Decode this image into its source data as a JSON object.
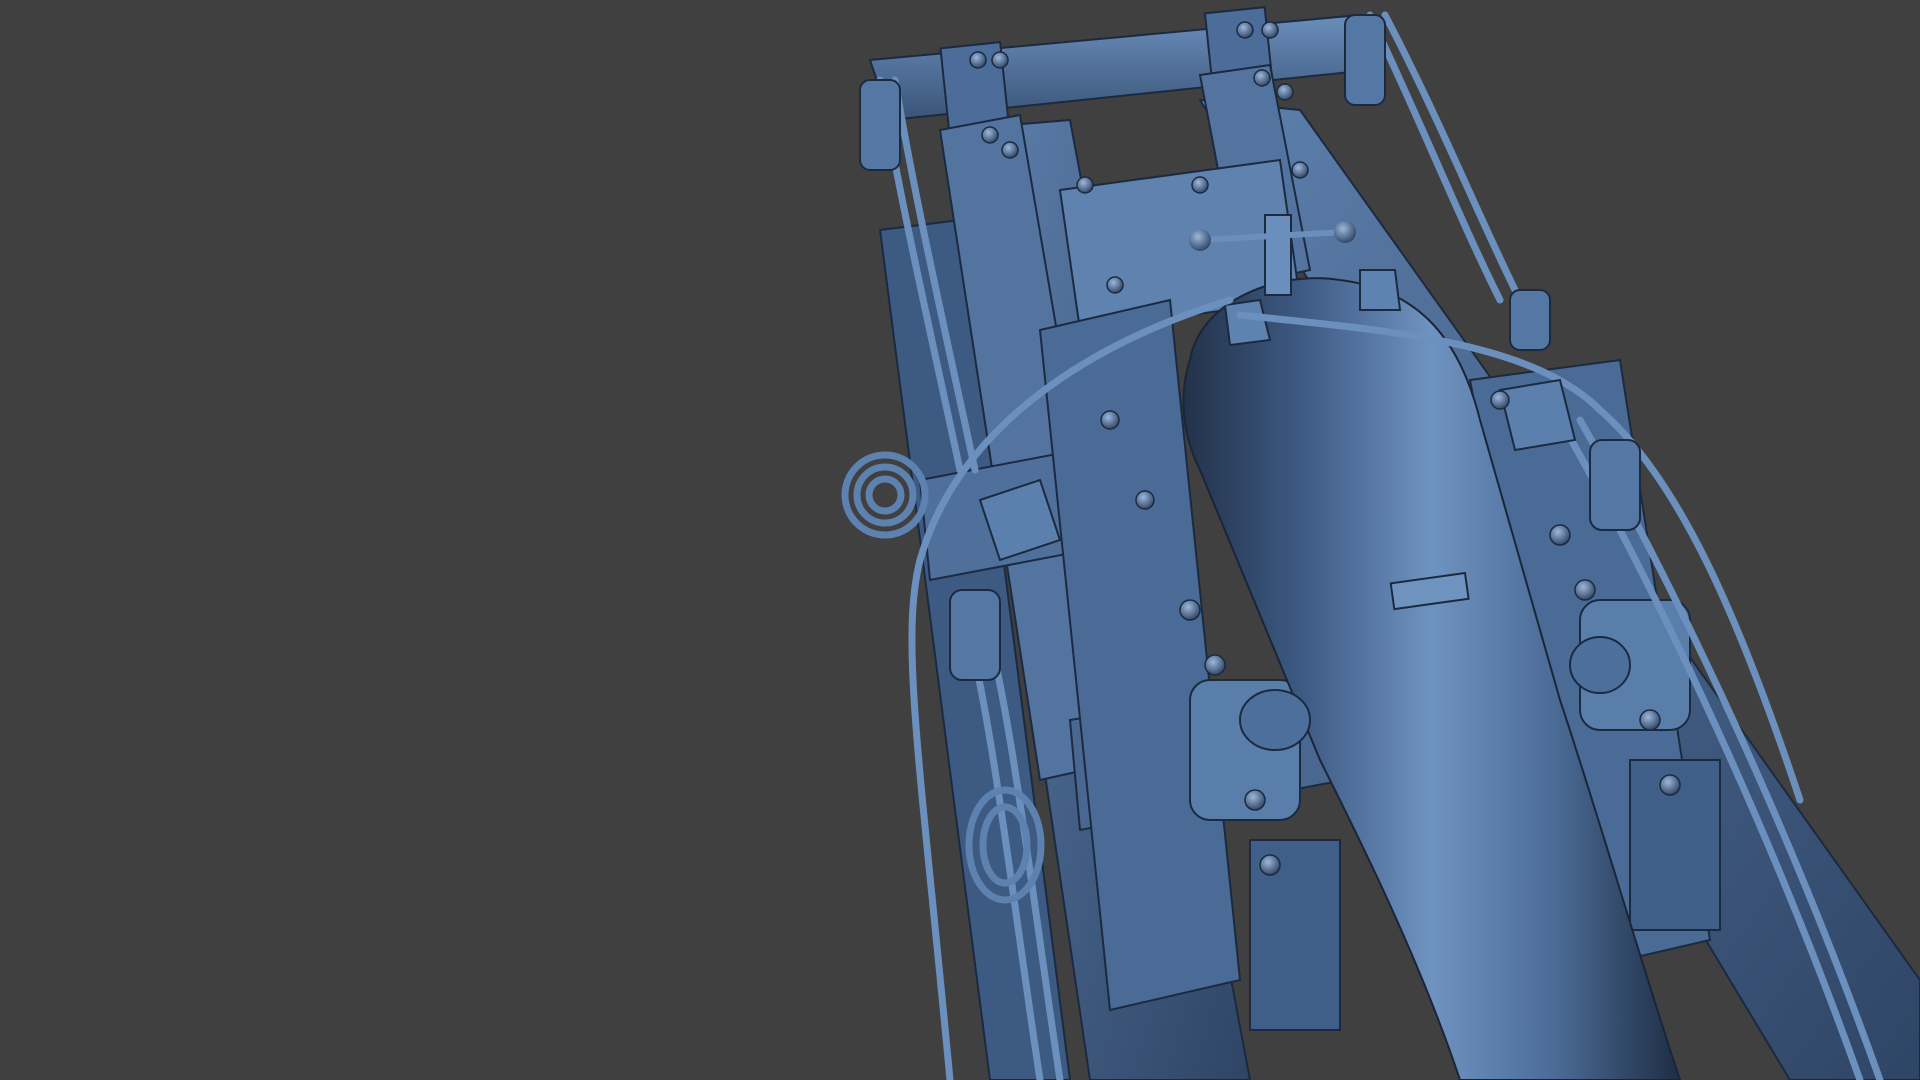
{
  "viewport": {
    "background_color": "#404040",
    "subject": "cannon-on-carriage-3d-model",
    "material_color": "#4f6f98",
    "material_highlight": "#7fa3cf",
    "material_shadow": "#23324a"
  }
}
